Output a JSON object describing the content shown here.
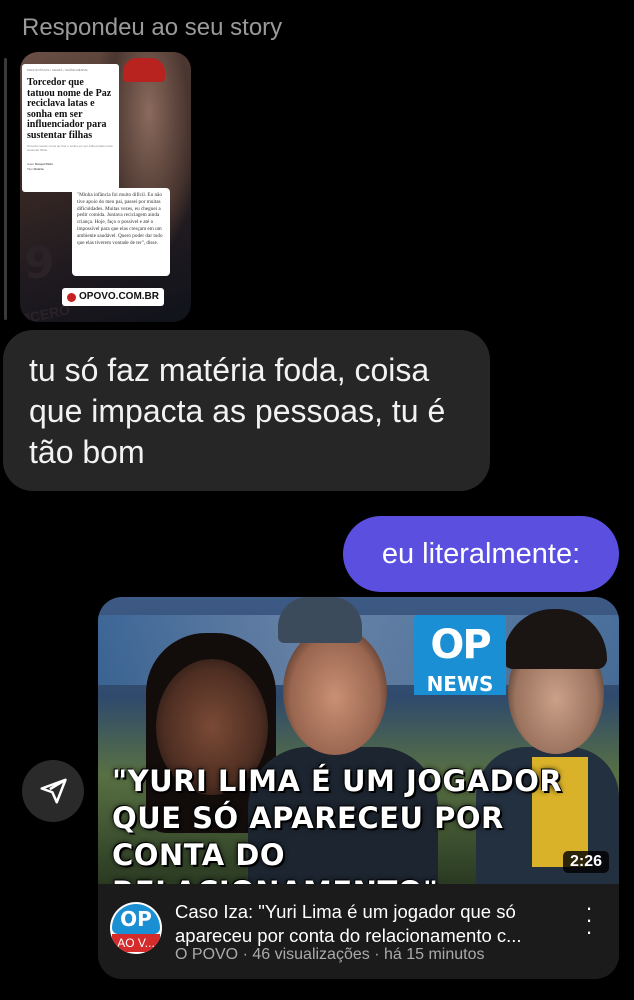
{
  "reply_header": "Respondeu ao seu story",
  "story": {
    "article_kicker": "MAIS NOTÍCIAS • CEARÁ • SAÚDE MENTAL",
    "article_headline": "Torcedor que tatuou nome de Paz reciclava latas e sonha em ser influenciador para sustentar filhas",
    "article_sub": "Torcedor tatuou nome de Paz e sonha em ser influenciador para sustentar filhas",
    "article_author_label": "Autor",
    "article_author": "Danyel Diniz",
    "article_type_label": "Tipo",
    "article_type": "Notícia",
    "shirt_number": "9",
    "shirt_name": "JCERO",
    "quote": "\"Minha infância foi muito difícil. Eu não tive apoio do meu pai, passei por muitas dificuldades. Muitas vezes, eu cheguei a pedir comida. Juntava reciclagem ainda criança. Hoje, faço o possível e até o impossível para que elas cresçam em um ambiente saudável. Quero poder dar tudo que elas tiverem vontade de ter\", disse.",
    "source": "OPOVO.COM.BR"
  },
  "messages": {
    "incoming": "tu só faz matéria foda, coisa que impacta as pessoas, tu é tão bom",
    "outgoing": "eu literalmente:"
  },
  "video": {
    "badge_op": "OP",
    "badge_news": "NEWS",
    "overlay_text": "\"YURI LIMA É UM JOGADOR QUE SÓ APARECEU POR CONTA DO RELACIONAMENTO\"",
    "duration": "2:26",
    "channel_logo_text": "OP",
    "channel_logo_label": "AO V...",
    "title": "Caso Iza: \"Yuri Lima é um jogador que só apareceu por conta do relacionamento c...",
    "meta": "O POVO · 46 visualizações · há 15 minutos"
  },
  "icons": {
    "share": "send-icon",
    "more": "more-vertical-icon"
  },
  "colors": {
    "outgoing_bubble": "#5b4fe0",
    "incoming_bubble": "#262626",
    "brand_blue": "#1b8fd3"
  }
}
